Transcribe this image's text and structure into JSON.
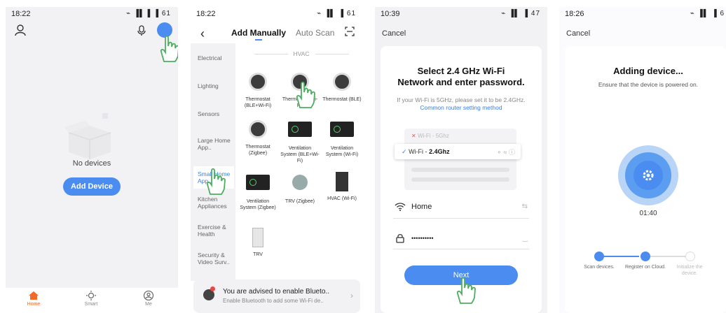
{
  "colors": {
    "accent": "#4a8cf0",
    "bg": "#f2f2f4"
  },
  "phone1": {
    "status_time": "18:22",
    "status_icons": "⌁ ▐▌▐ ▐ 61",
    "empty_text": "No devices",
    "add_button": "Add Device",
    "tabs": [
      {
        "label": "Home",
        "icon": "home-icon"
      },
      {
        "label": "Smart",
        "icon": "sun-icon"
      },
      {
        "label": "Me",
        "icon": "profile-icon"
      }
    ]
  },
  "phone2": {
    "status_time": "18:22",
    "status_icons": "⌁ ▐▌ ▐ 61",
    "title": "Add Manually",
    "auto_scan": "Auto Scan",
    "categories": [
      "Electrical",
      "Lighting",
      "Sensors",
      "Large Home App..",
      "Small Home App..",
      "Kitchen Appliances",
      "Exercise & Health",
      "Security & Video Surv.."
    ],
    "section": "HVAC",
    "devices": [
      "Thermostat (BLE+Wi-Fi)",
      "Thermostat (Wi-Fi)",
      "Thermostat (BLE)",
      "Thermostat (Zigbee)",
      "Ventilation System (BLE+Wi-Fi)",
      "Ventilation System (Wi-Fi)",
      "Ventilation System (Zigbee)",
      "TRV (Zigbee)",
      "HVAC (Wi-Fi)",
      "TRV"
    ],
    "bt_title": "You are advised to enable Blueto..",
    "bt_sub": "Enable Bluetooth to add some Wi-Fi de.."
  },
  "phone3": {
    "status_time": "10:39",
    "status_icons": "⌁ ▐▌ ▐ 47",
    "cancel": "Cancel",
    "heading_line1": "Select 2.4 GHz Wi-Fi",
    "heading_line2": "Network and enter password.",
    "hint": "If your Wi-Fi is 5GHz, please set it to be 2.4GHz.",
    "hint_link": "Common router setting method",
    "wifi_5g": "Wi-Fi - 5Ghz",
    "wifi_prefix": "Wi-Fi - ",
    "wifi_24g": "2.4Ghz",
    "network_name": "Home",
    "password_mask": "••••••••••",
    "next": "Next"
  },
  "phone4": {
    "status_time": "18:26",
    "status_icons": "⌁ ▐▌ ▐ 6",
    "cancel": "Cancel",
    "heading": "Adding device...",
    "hint": "Ensure that the device is powered on.",
    "timer": "01:40",
    "steps": [
      {
        "label": "Scan devices."
      },
      {
        "label": "Register on Cloud."
      },
      {
        "label": "Initialize the device."
      }
    ]
  }
}
